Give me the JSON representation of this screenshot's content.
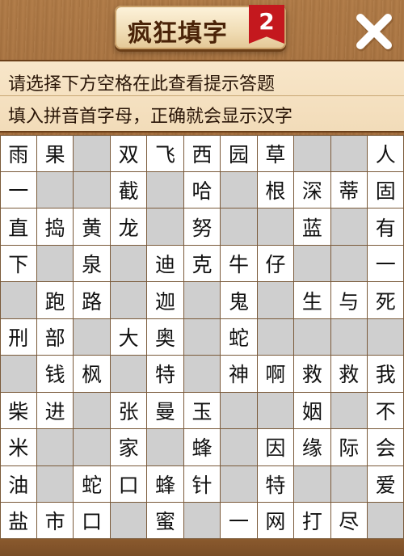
{
  "header": {
    "title": "疯狂填字",
    "badge": "2"
  },
  "close_icon": "close-icon",
  "hint": {
    "line1": "请选择下方空格在此查看提示答题",
    "line2": "填入拼音首字母，正确就会显示汉字"
  },
  "colors": {
    "wood": "#9b6535",
    "hint_bg": "#f4e0c0",
    "blank_cell": "#cfcfcf",
    "badge": "#c4181e"
  },
  "grid": {
    "rows": [
      [
        "雨",
        "果",
        "",
        "双",
        "飞",
        "西",
        "园",
        "草",
        "",
        "",
        "人"
      ],
      [
        "一",
        "",
        "",
        "截",
        "",
        "哈",
        "",
        "根",
        "深",
        "蒂",
        "固"
      ],
      [
        "直",
        "捣",
        "黄",
        "龙",
        "",
        "努",
        "",
        "",
        "蓝",
        "",
        "有"
      ],
      [
        "下",
        "",
        "泉",
        "",
        "迪",
        "克",
        "牛",
        "仔",
        "",
        "",
        "一"
      ],
      [
        "",
        "跑",
        "路",
        "",
        "迦",
        "",
        "鬼",
        "",
        "生",
        "与",
        "死"
      ],
      [
        "刑",
        "部",
        "",
        "大",
        "奥",
        "",
        "蛇",
        "",
        "",
        "",
        ""
      ],
      [
        "",
        "钱",
        "枫",
        "",
        "特",
        "",
        "神",
        "啊",
        "救",
        "救",
        "我"
      ],
      [
        "柴",
        "进",
        "",
        "张",
        "曼",
        "玉",
        "",
        "",
        "姻",
        "",
        "不"
      ],
      [
        "米",
        "",
        "",
        "家",
        "",
        "蜂",
        "",
        "因",
        "缘",
        "际",
        "会"
      ],
      [
        "油",
        "",
        "蛇",
        "口",
        "蜂",
        "针",
        "",
        "特",
        "",
        "",
        "爱"
      ],
      [
        "盐",
        "市",
        "口",
        "",
        "蜜",
        "",
        "一",
        "网",
        "打",
        "尽",
        ""
      ]
    ],
    "blank_mask": [
      [
        0,
        0,
        1,
        0,
        0,
        0,
        0,
        0,
        1,
        1,
        0
      ],
      [
        0,
        1,
        1,
        0,
        1,
        0,
        1,
        0,
        0,
        0,
        0
      ],
      [
        0,
        0,
        0,
        0,
        1,
        0,
        1,
        1,
        0,
        1,
        0
      ],
      [
        0,
        1,
        0,
        1,
        0,
        0,
        0,
        0,
        1,
        1,
        0
      ],
      [
        1,
        0,
        0,
        1,
        0,
        1,
        0,
        1,
        0,
        0,
        0
      ],
      [
        0,
        0,
        1,
        0,
        0,
        1,
        0,
        1,
        1,
        1,
        1
      ],
      [
        1,
        0,
        0,
        1,
        0,
        1,
        0,
        0,
        0,
        0,
        0
      ],
      [
        0,
        0,
        1,
        0,
        0,
        0,
        1,
        1,
        0,
        1,
        0
      ],
      [
        0,
        1,
        1,
        0,
        1,
        0,
        1,
        0,
        0,
        0,
        0
      ],
      [
        0,
        1,
        0,
        0,
        0,
        0,
        1,
        0,
        1,
        1,
        0
      ],
      [
        0,
        0,
        0,
        1,
        0,
        1,
        0,
        0,
        0,
        0,
        1
      ]
    ]
  }
}
